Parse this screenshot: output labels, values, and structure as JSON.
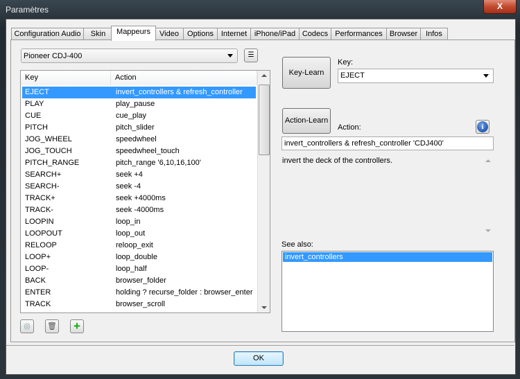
{
  "window": {
    "title": "Paramètres",
    "close": "X"
  },
  "tabs": [
    "Configuration Audio",
    "Skin",
    "Mappeurs",
    "Video",
    "Options",
    "Internet",
    "iPhone/iPad",
    "Codecs",
    "Performances",
    "Browser",
    "Infos"
  ],
  "active_tab": "Mappeurs",
  "mapper_select": "Pioneer CDJ-400",
  "table": {
    "headers": [
      "Key",
      "Action"
    ],
    "rows": [
      [
        "EJECT",
        "invert_controllers & refresh_controller 'C..."
      ],
      [
        "PLAY",
        "play_pause"
      ],
      [
        "CUE",
        "cue_play"
      ],
      [
        "PITCH",
        "pitch_slider"
      ],
      [
        "JOG_WHEEL",
        "speedwheel"
      ],
      [
        "JOG_TOUCH",
        "speedwheel_touch"
      ],
      [
        "PITCH_RANGE",
        "pitch_range '6,10,16,100'"
      ],
      [
        "SEARCH+",
        "seek +4"
      ],
      [
        "SEARCH-",
        "seek -4"
      ],
      [
        "TRACK+",
        "seek +4000ms"
      ],
      [
        "TRACK-",
        "seek -4000ms"
      ],
      [
        "LOOPIN",
        "loop_in"
      ],
      [
        "LOOPOUT",
        "loop_out"
      ],
      [
        "RELOOP",
        "reloop_exit"
      ],
      [
        "LOOP+",
        "loop_double"
      ],
      [
        "LOOP-",
        "loop_half"
      ],
      [
        "BACK",
        "browser_folder"
      ],
      [
        "ENTER",
        "holding ? recurse_folder : browser_enter"
      ],
      [
        "TRACK",
        "browser_scroll"
      ]
    ]
  },
  "right": {
    "key_learn": "Key-Learn",
    "key_label": "Key:",
    "key_value": "EJECT",
    "action_learn": "Action-Learn",
    "action_label": "Action:",
    "action_value": "invert_controllers & refresh_controller 'CDJ400'",
    "description": "invert the deck of the controllers.",
    "see_also_label": "See also:",
    "see_also": [
      "invert_controllers"
    ]
  },
  "ok": "OK",
  "colors": {
    "selection": "#3399ff"
  }
}
